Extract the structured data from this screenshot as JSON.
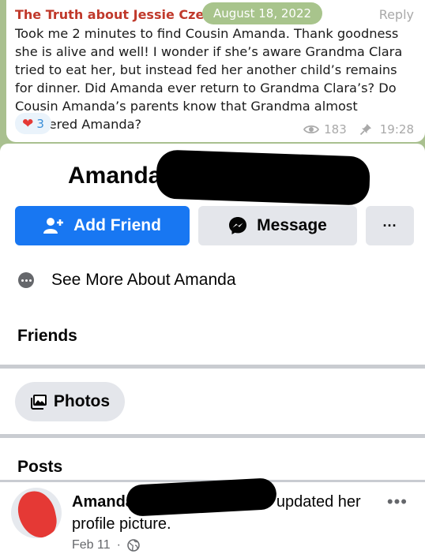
{
  "telegram": {
    "author": "The Truth about Jessie Czebotar",
    "date_pill": "August 18, 2022",
    "reply_label": "Reply",
    "message": "Took me 2 minutes to find Cousin Amanda. Thank goodness she is alive and well! I wonder if she’s aware Grandma Clara tried to eat her, but instead fed her another child’s remains for dinner. Did Amanda ever return to Grandma Clara’s? Do Cousin Amanda’s parents know that Grandma almost murdered Amanda?",
    "reaction": {
      "icon": "heart-icon",
      "count": "3",
      "color": "#e53935"
    },
    "views": "183",
    "time": "19:28"
  },
  "facebook": {
    "profile_name": "Amanda",
    "add_friend_label": "Add Friend",
    "message_label": "Message",
    "more_label": "···",
    "see_more_label": "See More About Amanda",
    "friends_title": "Friends",
    "photos_label": "Photos",
    "posts_title": "Posts",
    "post": {
      "author": "Amanda",
      "action": "updated her profile picture.",
      "date": "Feb 11",
      "separator": "·",
      "audience_icon": "globe-icon"
    },
    "accent_color": "#1877f2"
  }
}
